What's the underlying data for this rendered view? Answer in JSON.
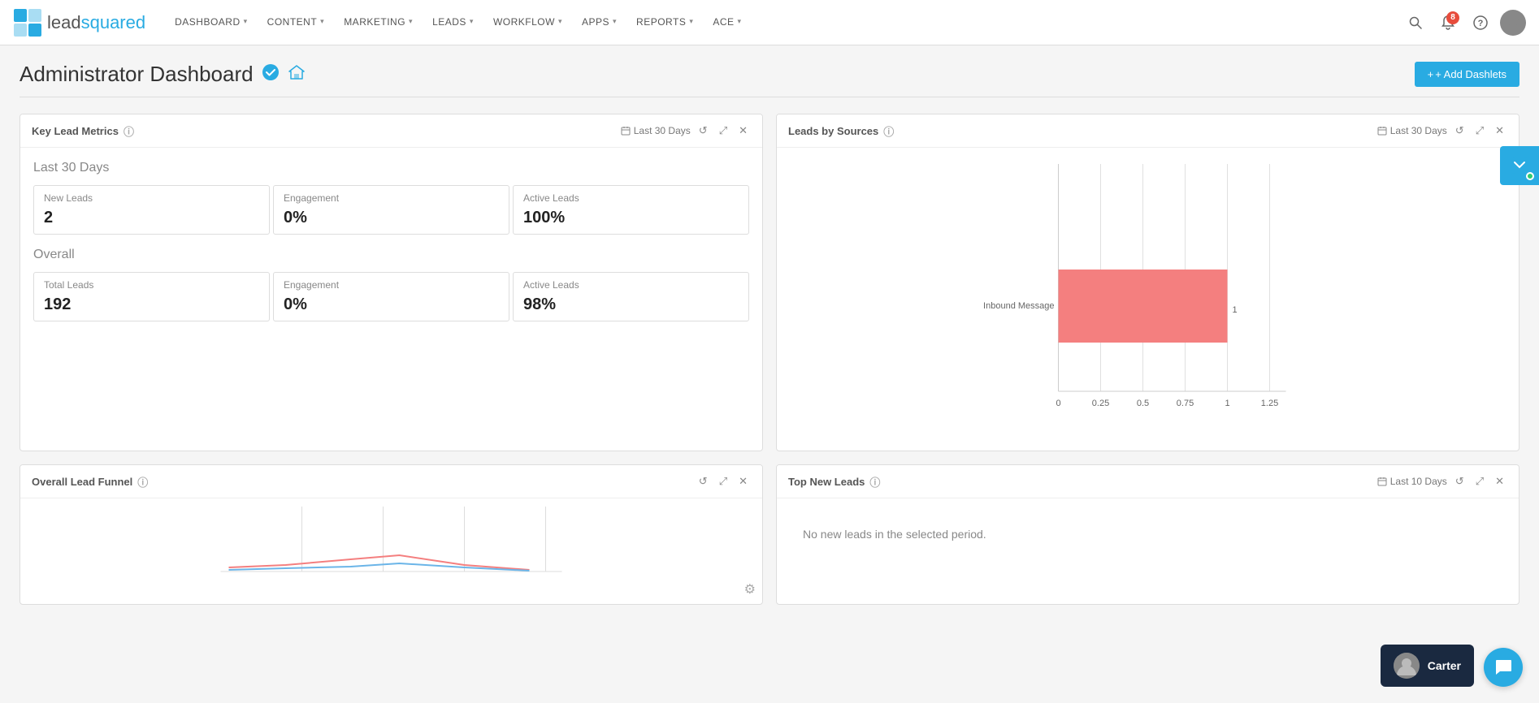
{
  "logo": {
    "lead_text": "lead",
    "squared_text": "squared"
  },
  "nav": {
    "items": [
      {
        "label": "DASHBOARD",
        "id": "dashboard"
      },
      {
        "label": "CONTENT",
        "id": "content"
      },
      {
        "label": "MARKETING",
        "id": "marketing"
      },
      {
        "label": "LEADS",
        "id": "leads"
      },
      {
        "label": "WORKFLOW",
        "id": "workflow"
      },
      {
        "label": "APPS",
        "id": "apps"
      },
      {
        "label": "REPORTS",
        "id": "reports"
      },
      {
        "label": "ACE",
        "id": "ace"
      }
    ],
    "notification_count": "8"
  },
  "page": {
    "title": "Administrator Dashboard",
    "add_dashlets_label": "+ Add Dashlets"
  },
  "key_lead_metrics": {
    "title": "Key Lead Metrics",
    "date_range": "Last 30 Days",
    "section_30days": "Last 30 Days",
    "section_overall": "Overall",
    "metrics_30days": [
      {
        "label": "New Leads",
        "value": "2"
      },
      {
        "label": "Engagement",
        "value": "0%"
      },
      {
        "label": "Active Leads",
        "value": "100%"
      }
    ],
    "metrics_overall": [
      {
        "label": "Total Leads",
        "value": "192"
      },
      {
        "label": "Engagement",
        "value": "0%"
      },
      {
        "label": "Active Leads",
        "value": "98%"
      }
    ]
  },
  "leads_by_sources": {
    "title": "Leads by Sources",
    "date_range": "Last 30 Days",
    "chart": {
      "y_label": "Inbound Message",
      "bar_value": "1",
      "x_labels": [
        "0",
        "0.25",
        "0.5",
        "0.75",
        "1",
        "1.25"
      ],
      "bar_width_pct": 72
    }
  },
  "overall_lead_funnel": {
    "title": "Overall Lead Funnel"
  },
  "top_new_leads": {
    "title": "Top New Leads",
    "date_range": "Last 10 Days",
    "no_data_text": "No new leads in the selected period."
  },
  "carter": {
    "name": "Carter"
  },
  "icons": {
    "chevron": "▾",
    "search": "🔍",
    "bell": "🔔",
    "question": "?",
    "user": "👤",
    "verified": "✔",
    "home": "⌂",
    "plus": "+",
    "calendar": "📅",
    "refresh": "↺",
    "expand": "⤢",
    "close": "✕",
    "info": "ⓘ",
    "gear": "⚙"
  }
}
